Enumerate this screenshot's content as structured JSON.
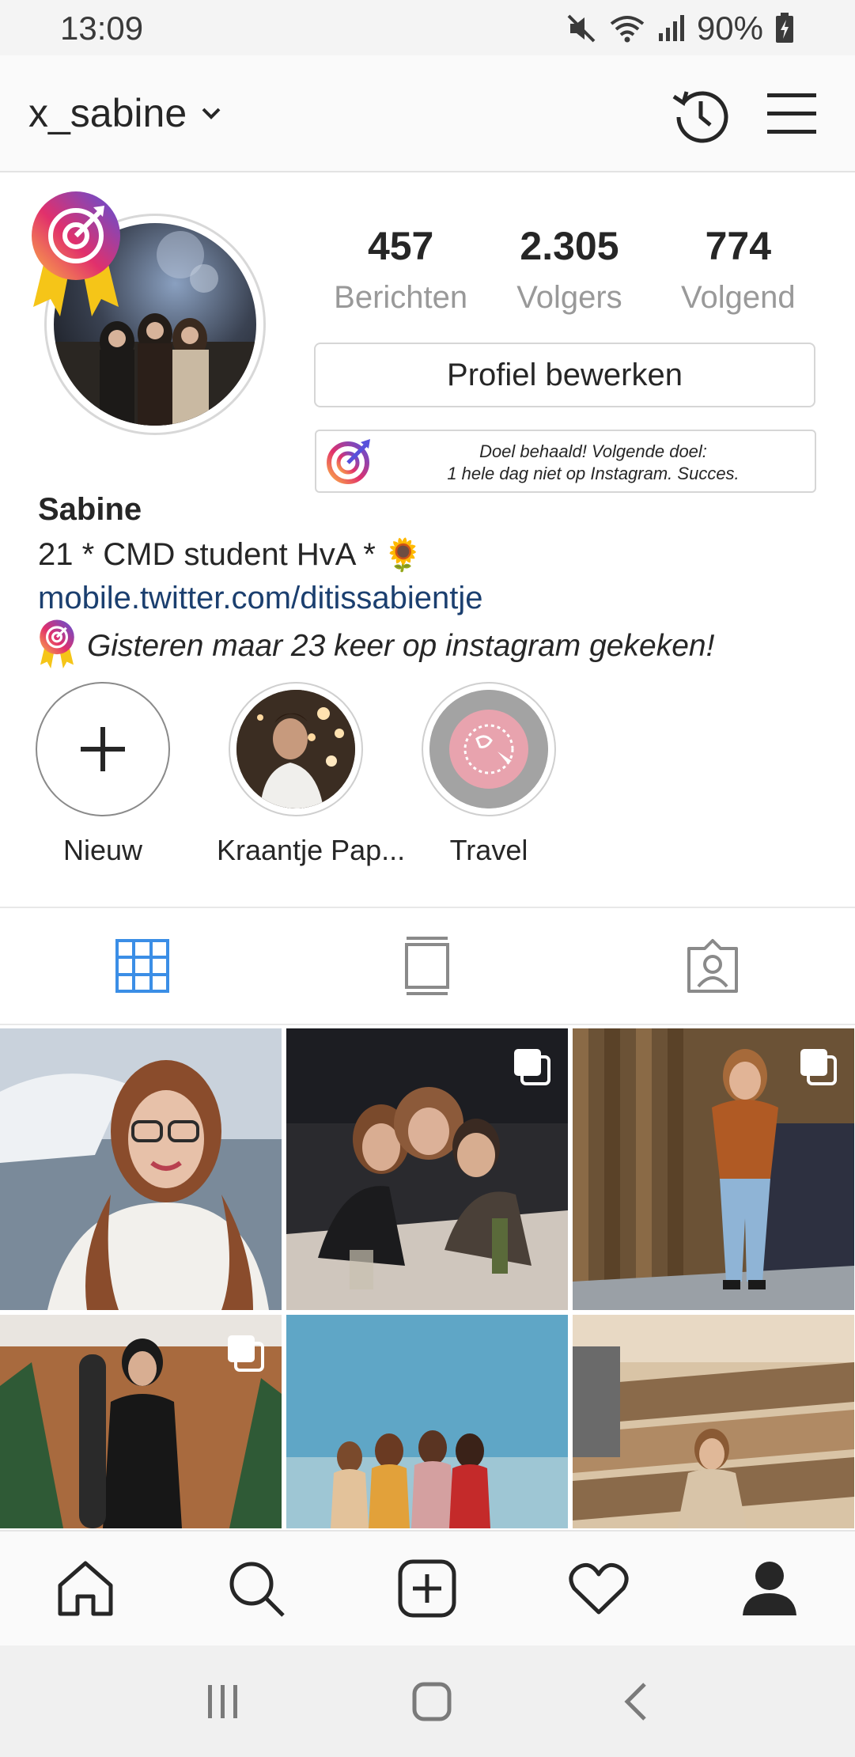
{
  "status_bar": {
    "time": "13:09",
    "battery": "90%"
  },
  "header": {
    "username": "x_sabine"
  },
  "stats": [
    {
      "count": "457",
      "label": "Berichten"
    },
    {
      "count": "2.305",
      "label": "Volgers"
    },
    {
      "count": "774",
      "label": "Volgend"
    }
  ],
  "edit_profile_label": "Profiel bewerken",
  "goal_box": {
    "line1": "Doel behaald! Volgende doel:",
    "line2": "1 hele dag niet op Instagram. Succes."
  },
  "bio": {
    "name": "Sabine",
    "text": "21 * CMD student HvA *",
    "emoji": "🌻",
    "link": "mobile.twitter.com/ditissabientje",
    "goal_text": "Gisteren maar 23 keer op instagram gekeken!"
  },
  "highlights": [
    {
      "label": "Nieuw"
    },
    {
      "label": "Kraantje Pap..."
    },
    {
      "label": "Travel"
    }
  ],
  "tabs": [
    "grid-icon",
    "feed-icon",
    "tagged-icon"
  ],
  "colors": {
    "active_tab": "#3b8ee6",
    "link": "#1b3f6f"
  }
}
